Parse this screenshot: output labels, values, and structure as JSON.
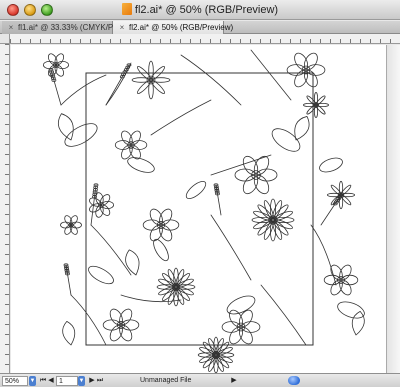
{
  "window": {
    "title": "fl2.ai* @ 50% (RGB/Preview)"
  },
  "tabs": [
    {
      "label": "fl1.ai* @ 33.33% (CMYK/Preview)",
      "active": false
    },
    {
      "label": "fl2.ai* @ 50% (RGB/Preview)",
      "active": true
    }
  ],
  "status": {
    "zoom": "50%",
    "page": "1",
    "file_status": "Unmanaged File"
  },
  "colors": {
    "accent": "#4b7fd0",
    "canvas": "#ffffff",
    "line": "#333333"
  },
  "icons": {
    "close_tab": "close-icon",
    "document": "document-icon",
    "first_page": "first-page-icon",
    "prev_page": "previous-page-icon",
    "next_page": "next-page-icon",
    "last_page": "last-page-icon"
  }
}
